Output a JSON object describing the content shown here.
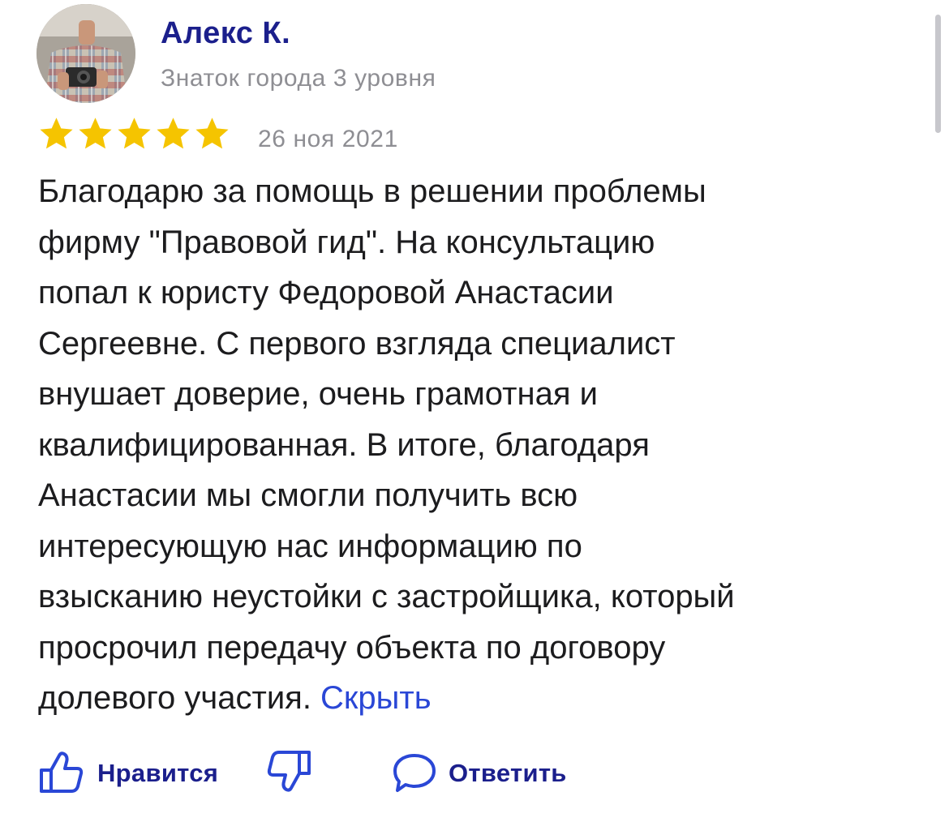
{
  "review": {
    "author": {
      "name": "Алекс К.",
      "level": "Знаток города 3 уровня"
    },
    "rating": 5,
    "rating_max": 5,
    "date": "26 ноя 2021",
    "text_lines": [
      "Благодарю за помощь в решении проблемы",
      "фирму \"Правовой гид\". На консультацию",
      "попал к юристу Федоровой Анастасии",
      "Сергеевне. С первого взгляда специалист",
      "внушает доверие, очень грамотная и",
      "квалифицированная. В итоге, благодаря",
      "Анастасии мы смогли получить всю",
      "интересующую нас информацию по",
      "взысканию неустойки с застройщика, который",
      "просрочил передачу объекта по договору",
      "долевого участия. "
    ],
    "hide_link": "Скрыть"
  },
  "actions": {
    "like_label": "Нравится",
    "reply_label": "Ответить"
  },
  "icons": {
    "like": "thumbs-up-icon",
    "dislike": "thumbs-down-icon",
    "reply": "speech-bubble-icon",
    "star": "star-icon"
  },
  "colors": {
    "name": "#1b1f8c",
    "secondary": "#8e8e93",
    "star": "#f5c400",
    "link": "#2a47d6",
    "text": "#1c1c1e"
  }
}
